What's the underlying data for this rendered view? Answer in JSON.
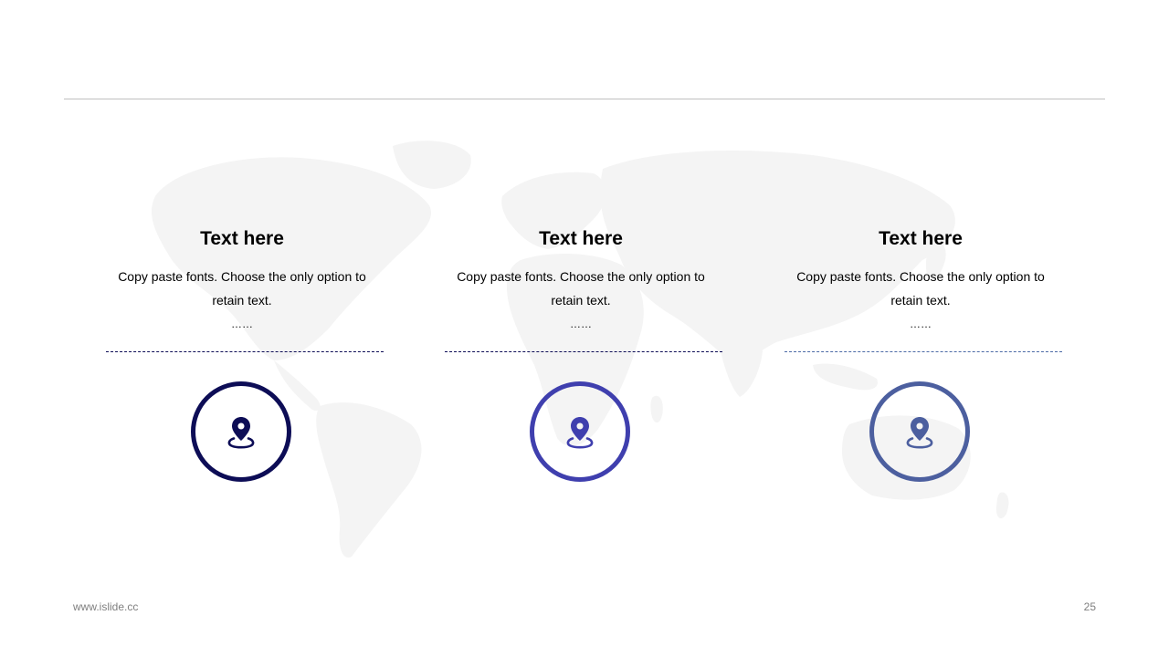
{
  "slide": {
    "page_number": "25",
    "footer_url": "www.islide.cc"
  },
  "columns": [
    {
      "title": "Text here",
      "body": "Copy paste fonts. Choose the only option to retain text.",
      "ellipsis": "……",
      "accent": "#0d0d56",
      "icon": "location-pin-icon"
    },
    {
      "title": "Text here",
      "body": "Copy paste fonts. Choose the only option to retain text.",
      "ellipsis": "……",
      "accent": "#3f3fae",
      "icon": "location-pin-icon"
    },
    {
      "title": "Text here",
      "body": "Copy paste fonts. Choose the only option to retain text.",
      "ellipsis": "……",
      "accent": "#4c5f9f",
      "icon": "location-pin-icon"
    }
  ],
  "colors": {
    "rule": "#bfbfbf",
    "map": "#f4f4f4",
    "footer_text": "#7f7f7f"
  }
}
